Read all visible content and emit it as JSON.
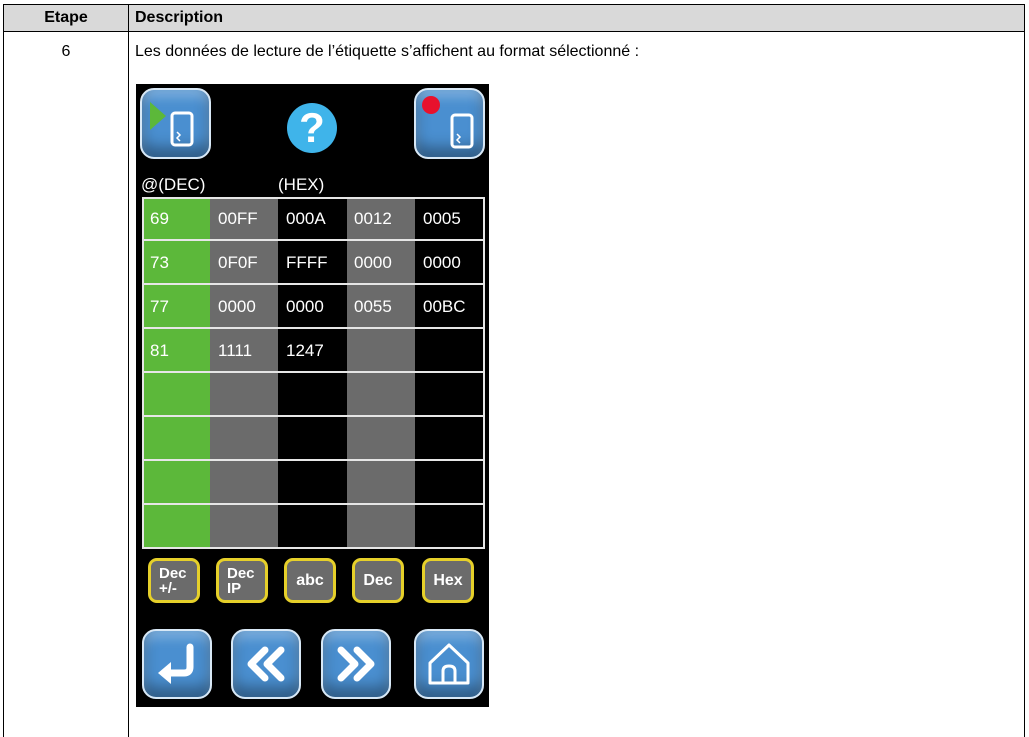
{
  "table": {
    "header_step": "Etape",
    "header_description": "Description",
    "step": "6",
    "description": "Les données de lecture de l’étiquette s’affichent au format sélectionné :"
  },
  "screen": {
    "top_buttons": {
      "start_read": "start-read-icon",
      "help": "?",
      "stop_read": "stop-read-icon"
    },
    "labels": {
      "address": "@(DEC)",
      "data_format": "(HEX)"
    },
    "rows": [
      [
        "69",
        "00FF",
        "000A",
        "0012",
        "0005"
      ],
      [
        "73",
        "0F0F",
        "FFFF",
        "0000",
        "0000"
      ],
      [
        "77",
        "0000",
        "0000",
        "0055",
        "00BC"
      ],
      [
        "81",
        "1111",
        "1247",
        "",
        ""
      ],
      [
        "",
        "",
        "",
        "",
        ""
      ],
      [
        "",
        "",
        "",
        "",
        ""
      ],
      [
        "",
        "",
        "",
        "",
        ""
      ],
      [
        "",
        "",
        "",
        "",
        ""
      ]
    ],
    "format_buttons": [
      {
        "line1": "Dec",
        "line2": "+/-"
      },
      {
        "line1": "Dec",
        "line2": "IP"
      },
      {
        "line1": "abc",
        "line2": ""
      },
      {
        "line1": "Dec",
        "line2": ""
      },
      {
        "line1": "Hex",
        "line2": ""
      }
    ],
    "nav_buttons": [
      "return-icon",
      "page-previous-icon",
      "page-next-icon",
      "home-icon"
    ],
    "colors": {
      "address_column": "#5cb83a",
      "gray_column": "#6b6b6b",
      "tile_blue": "#4a8fd0",
      "format_border": "#e6d02a",
      "help_blue": "#3fb4ea",
      "record_red": "#e8112d"
    }
  }
}
